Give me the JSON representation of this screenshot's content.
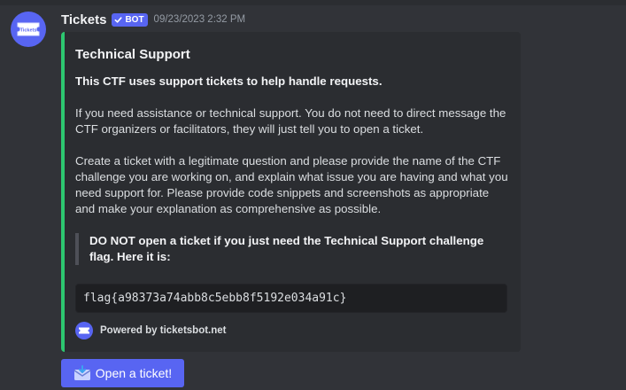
{
  "message": {
    "author": "Tickets",
    "bot_tag": "BOT",
    "timestamp": "09/23/2023 2:32 PM",
    "avatar_icon": "ticket-icon"
  },
  "embed": {
    "accent_color": "#2dc770",
    "title": "Technical Support",
    "intro_bold": "This CTF uses support tickets to help handle requests.",
    "paragraph_1": "If you need assistance or technical support. You do not need to direct message the CTF organizers or facilitators, they will just tell you to open a ticket.",
    "paragraph_2": "Create a ticket with a legitimate question and please provide the name of the CTF challenge you are working on, and explain what issue you are having and what you need support for. Please provide code snippets and screenshots as appropriate and make your explanation as comprehensive as possible.",
    "quote": "DO NOT open a ticket if you just need the Technical Support challenge flag. Here it is:",
    "code": "flag{a98373a74abb8c5ebb8f5192e034a91c}",
    "footer_text": "Powered by ticketsbot.net"
  },
  "button": {
    "label": "Open a ticket!",
    "icon": "envelope-icon",
    "color": "#5865f2"
  }
}
